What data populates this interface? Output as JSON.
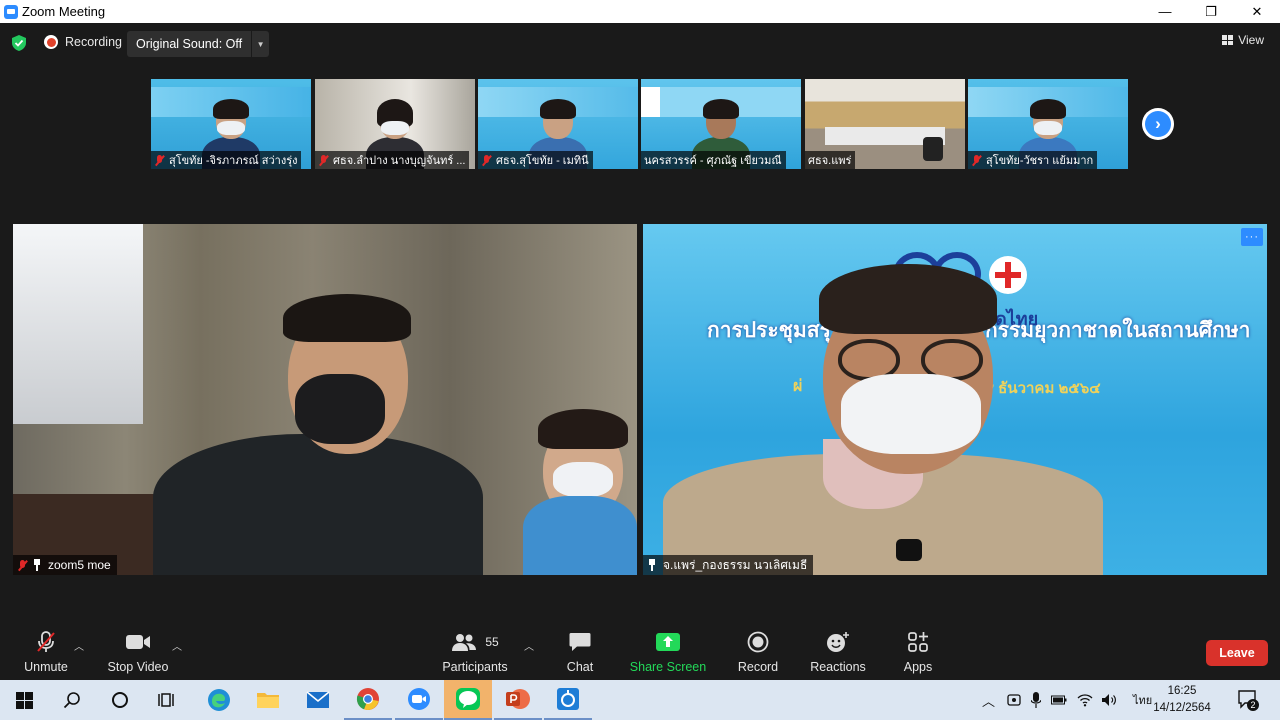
{
  "window": {
    "title": "Zoom Meeting",
    "minimize": "—",
    "maximize": "❐",
    "close": "✕"
  },
  "topbar": {
    "recording_label": "Recording",
    "original_sound_label": "Original Sound: Off",
    "view_label": "View"
  },
  "thumbnails": [
    {
      "name": "สุโขทัย -จิรภาภรณ์ สว่างรุ่ง"
    },
    {
      "name": "ศธจ.ลำปาง นางบุญจันทร์ ..."
    },
    {
      "name": "ศธจ.สุโขทัย - เมทินี"
    },
    {
      "name": "นครสวรรค์ - ศุภณัฐ เขียวมณี"
    },
    {
      "name": "ศธจ.แพร่"
    },
    {
      "name": "สุโขทัย-วัชรา แย้มมาก"
    }
  ],
  "main_tiles": {
    "left_name": "zoom5 moe",
    "right_name": "จ.แพร่_กองธรรม นวเลิศเมธี",
    "banner_line1": "การประชุมสรุป",
    "banner_line1b": "กรรมยุวกาชาดในสถานศึกษา",
    "banner_sub": "ผ่",
    "banner_date": "๙ ธันวาคม ๒๕๖๔",
    "banner_brand": "ดไทย",
    "more_label": "···"
  },
  "controls": {
    "unmute": "Unmute",
    "stop_video": "Stop Video",
    "participants": "Participants",
    "participants_count": "55",
    "chat": "Chat",
    "share_screen": "Share Screen",
    "record": "Record",
    "reactions": "Reactions",
    "apps": "Apps",
    "leave": "Leave"
  },
  "taskbar": {
    "language": "ไทย",
    "time": "16:25",
    "date": "14/12/2564",
    "notifications": "2"
  },
  "colors": {
    "zoom_blue": "#2d8cff",
    "leave_red": "#d9322b",
    "share_green": "#23d959",
    "taskbar": "#dce6f2"
  }
}
